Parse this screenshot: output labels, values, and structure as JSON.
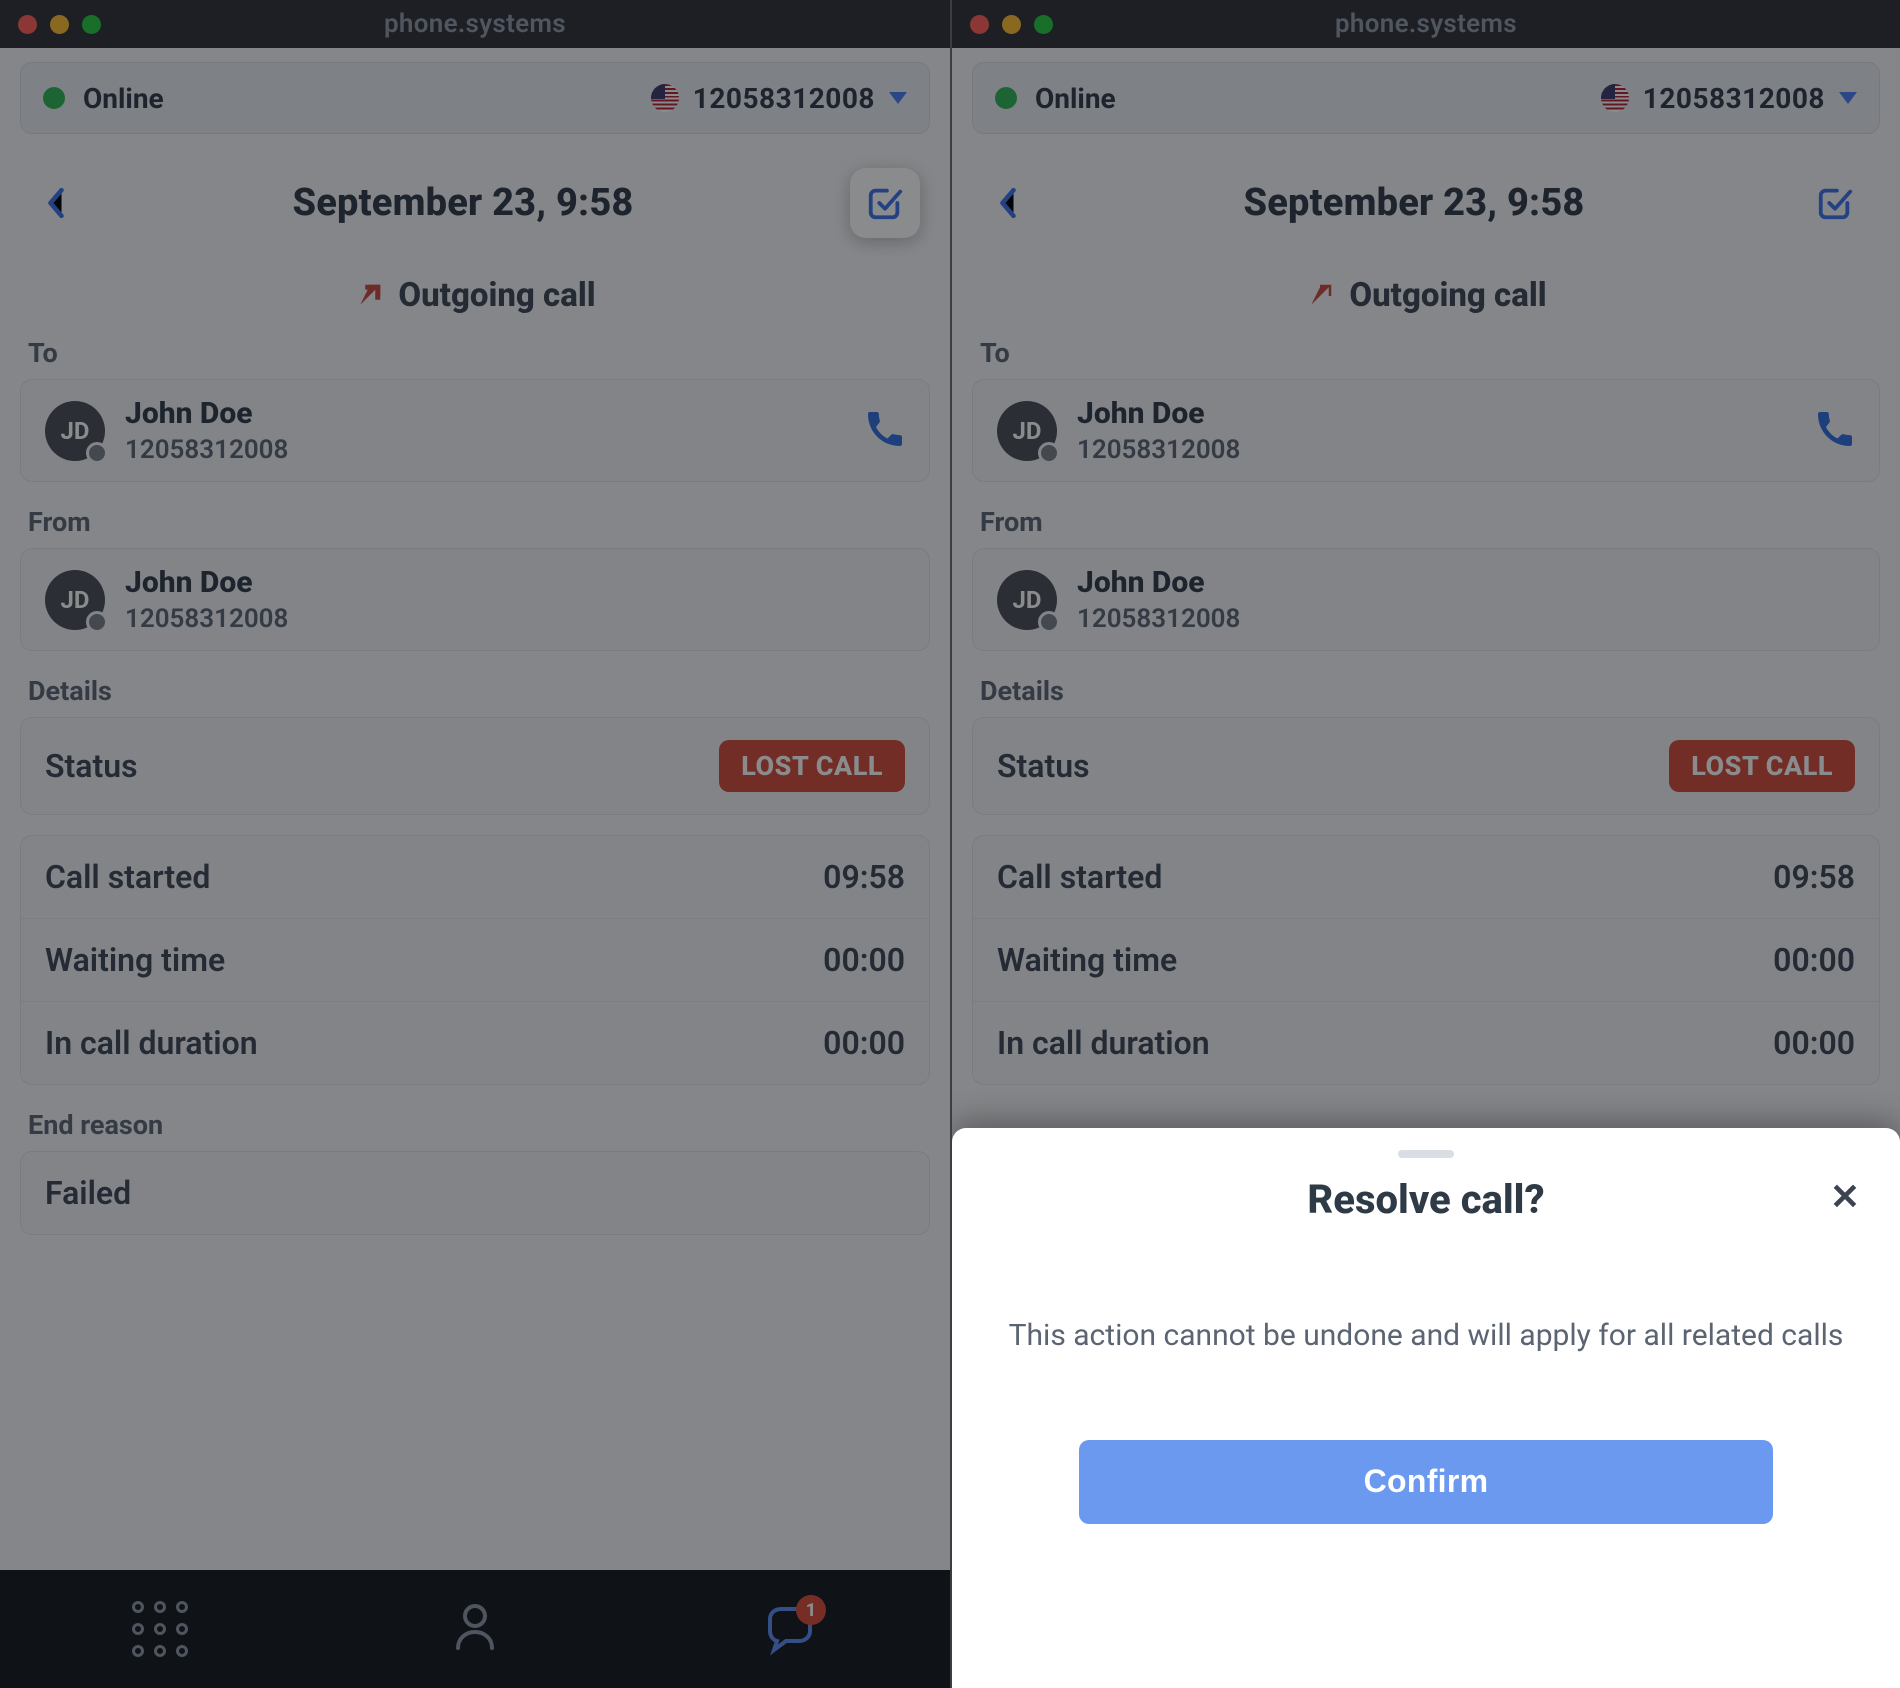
{
  "app_title": "phone.systems",
  "status": {
    "label": "Online",
    "number": "12058312008"
  },
  "header": {
    "date": "September 23, 9:58"
  },
  "call_type": "Outgoing call",
  "sections": {
    "to": "To",
    "from": "From",
    "details": "Details",
    "end": "End reason"
  },
  "contact": {
    "initials": "JD",
    "name": "John Doe",
    "number": "12058312008"
  },
  "details": {
    "status_key": "Status",
    "status_badge": "LOST CALL",
    "rows": [
      {
        "k": "Call started",
        "v": "09:58"
      },
      {
        "k": "Waiting time",
        "v": "00:00"
      },
      {
        "k": "In call duration",
        "v": "00:00"
      }
    ]
  },
  "end_reason": "Failed",
  "tabbar": {
    "notif_count": "1"
  },
  "modal": {
    "title": "Resolve call?",
    "body": "This action cannot be undone and will apply for all related calls",
    "confirm": "Confirm"
  }
}
